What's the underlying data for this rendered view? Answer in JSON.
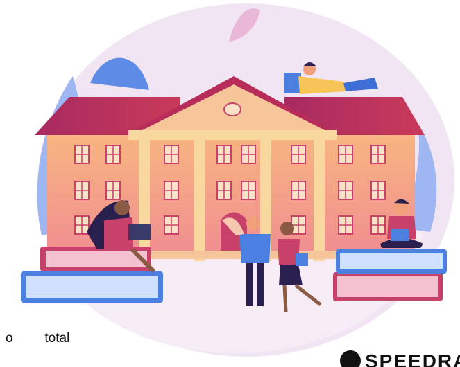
{
  "caption": {
    "text": "o   total"
  },
  "logo": {
    "text": "SPEEDRA"
  },
  "colors": {
    "blob": "#efe3f2",
    "roof": "#b8305a",
    "wall_top": "#f8b37e",
    "wall_bottom": "#f28e8c",
    "pillar": "#f9d8a0",
    "window": "#fbe2c7",
    "book_blue": "#4b7fe0",
    "book_red": "#c8416a"
  },
  "icons": [
    "university-building",
    "student-reading",
    "student-laptop",
    "students-talking",
    "book-stack",
    "logo-mark"
  ]
}
